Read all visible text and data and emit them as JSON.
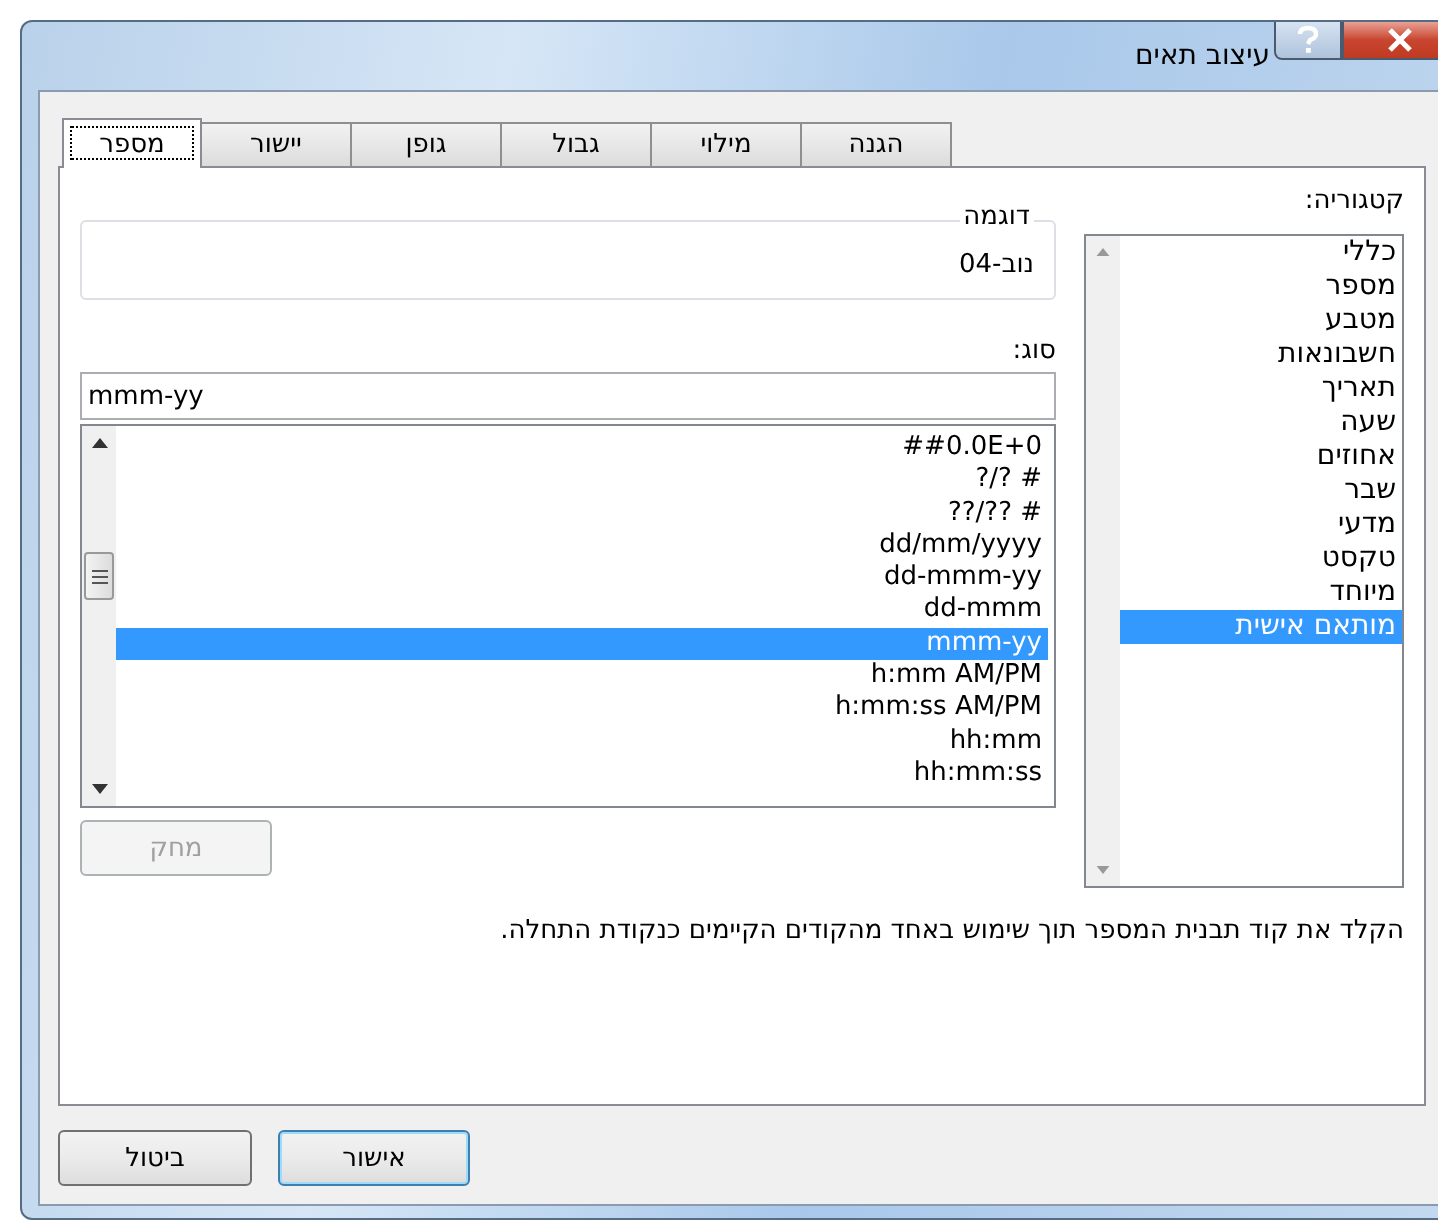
{
  "window": {
    "title": "עיצוב תאים"
  },
  "tabs": [
    {
      "label": "הגנה",
      "selected": false
    },
    {
      "label": "מילוי",
      "selected": false
    },
    {
      "label": "גבול",
      "selected": false
    },
    {
      "label": "גופן",
      "selected": false
    },
    {
      "label": "יישור",
      "selected": false
    },
    {
      "label": "מספר",
      "selected": true
    }
  ],
  "category": {
    "label": "קטגוריה:",
    "items": [
      {
        "label": "כללי",
        "selected": false
      },
      {
        "label": "מספר",
        "selected": false
      },
      {
        "label": "מטבע",
        "selected": false
      },
      {
        "label": "חשבונאות",
        "selected": false
      },
      {
        "label": "תאריך",
        "selected": false
      },
      {
        "label": "שעה",
        "selected": false
      },
      {
        "label": "אחוזים",
        "selected": false
      },
      {
        "label": "שבר",
        "selected": false
      },
      {
        "label": "מדעי",
        "selected": false
      },
      {
        "label": "טקסט",
        "selected": false
      },
      {
        "label": "מיוחד",
        "selected": false
      },
      {
        "label": "מותאם אישית",
        "selected": true
      }
    ]
  },
  "sample": {
    "label": "דוגמה",
    "value": "נוב-04"
  },
  "type": {
    "label": "סוג:",
    "value": "mmm-yy",
    "items": [
      {
        "label": "##0.0E+0",
        "selected": false
      },
      {
        "label": "# ?/?",
        "selected": false
      },
      {
        "label": "# ??/??",
        "selected": false
      },
      {
        "label": "dd/mm/yyyy",
        "selected": false
      },
      {
        "label": "dd-mmm-yy",
        "selected": false
      },
      {
        "label": "dd-mmm",
        "selected": false
      },
      {
        "label": "mmm-yy",
        "selected": true
      },
      {
        "label": "h:mm AM/PM",
        "selected": false
      },
      {
        "label": "h:mm:ss AM/PM",
        "selected": false
      },
      {
        "label": "hh:mm",
        "selected": false
      },
      {
        "label": "hh:mm:ss",
        "selected": false
      }
    ]
  },
  "delete_button": {
    "label": "מחק",
    "disabled": true
  },
  "description": "הקלד את קוד תבנית המספר תוך שימוש באחד מהקודים הקיימים כנקודת התחלה.",
  "buttons": {
    "ok": "אישור",
    "cancel": "ביטול"
  }
}
